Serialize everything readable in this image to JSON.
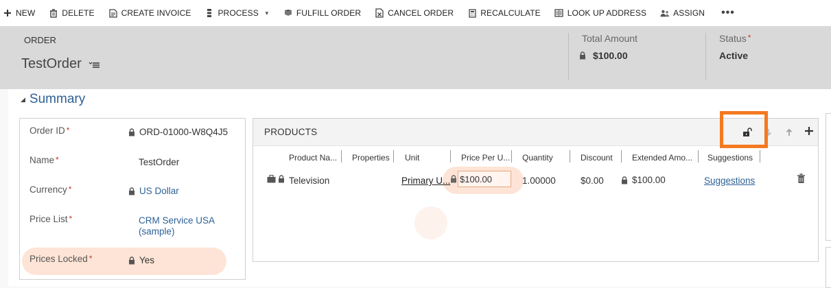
{
  "commands": [
    {
      "label": "NEW",
      "icon": "plus-icon"
    },
    {
      "label": "DELETE",
      "icon": "trash-icon"
    },
    {
      "label": "CREATE INVOICE",
      "icon": "invoice-icon"
    },
    {
      "label": "PROCESS",
      "icon": "process-icon"
    },
    {
      "label": "FULFILL ORDER",
      "icon": "fulfill-icon"
    },
    {
      "label": "CANCEL ORDER",
      "icon": "cancel-order-icon"
    },
    {
      "label": "RECALCULATE",
      "icon": "calculator-icon"
    },
    {
      "label": "LOOK UP ADDRESS",
      "icon": "address-book-icon"
    },
    {
      "label": "ASSIGN",
      "icon": "assign-icon"
    }
  ],
  "more_label": "•••",
  "header": {
    "entity_type": "ORDER",
    "record_name": "TestOrder",
    "total_amount_label": "Total Amount",
    "total_amount_value": "$100.00",
    "status_label": "Status",
    "status_value": "Active"
  },
  "section": {
    "title": "Summary"
  },
  "form": {
    "order_id": {
      "label": "Order ID",
      "value": "ORD-01000-W8Q4J5"
    },
    "name": {
      "label": "Name",
      "value": "TestOrder"
    },
    "currency": {
      "label": "Currency",
      "value": "US Dollar"
    },
    "price_list": {
      "label": "Price List",
      "value_line1": "CRM Service USA",
      "value_line2": "(sample)"
    },
    "prices_locked": {
      "label": "Prices Locked",
      "value": "Yes"
    }
  },
  "products": {
    "title": "PRODUCTS",
    "columns": [
      "Product Na...",
      "Properties",
      "Unit",
      "Price Per U...",
      "Quantity",
      "Discount",
      "Extended Amo...",
      "Suggestions"
    ],
    "rows": [
      {
        "product": "Television",
        "unit": "Primary U...",
        "price": "$100.00",
        "quantity": "1.00000",
        "discount": "$0.00",
        "extended": "$100.00",
        "suggestions": "Suggestions"
      }
    ]
  },
  "colors": {
    "accent_orange": "#f47920",
    "highlight": "#fde4d6",
    "link_blue": "#2d6096",
    "header_bg": "#d9d9d9"
  }
}
